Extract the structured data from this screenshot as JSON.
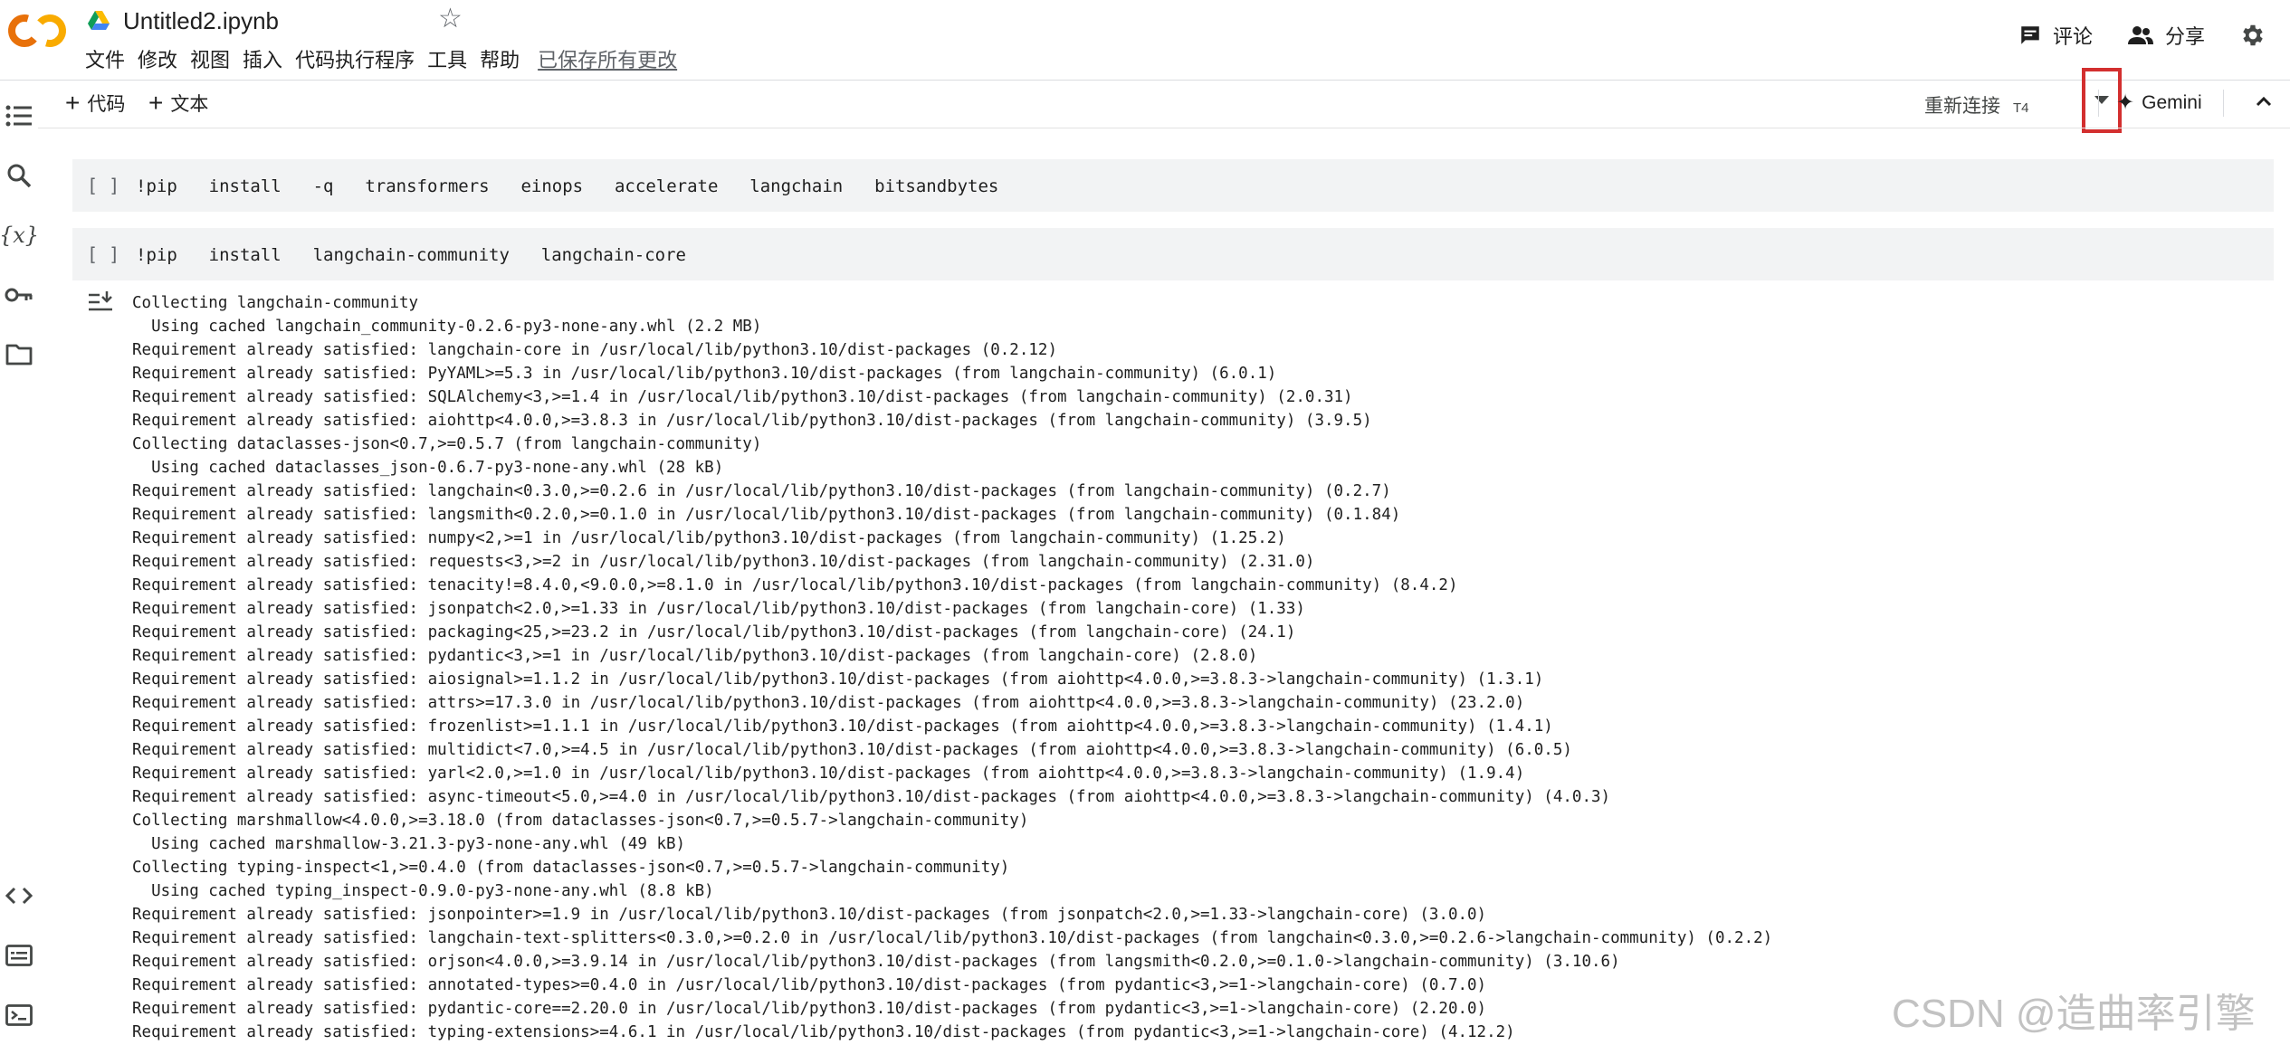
{
  "header": {
    "doc_title": "Untitled2.ipynb",
    "menus": [
      "文件",
      "修改",
      "视图",
      "插入",
      "代码执行程序",
      "工具",
      "帮助"
    ],
    "saved_status": "已保存所有更改",
    "comment_label": "评论",
    "share_label": "分享"
  },
  "toolbar": {
    "add_code_label": "代码",
    "add_text_label": "文本",
    "reconnect_label": "重新连接",
    "runtime_type": "T4",
    "gemini_label": "Gemini"
  },
  "cells": [
    {
      "bracket": "[ ]",
      "code": "!pip  install  -q  transformers  einops  accelerate  langchain  bitsandbytes"
    },
    {
      "bracket": "[ ]",
      "code": "!pip  install  langchain-community  langchain-core"
    }
  ],
  "output_lines": [
    "Collecting langchain-community",
    "  Using cached langchain_community-0.2.6-py3-none-any.whl (2.2 MB)",
    "Requirement already satisfied: langchain-core in /usr/local/lib/python3.10/dist-packages (0.2.12)",
    "Requirement already satisfied: PyYAML>=5.3 in /usr/local/lib/python3.10/dist-packages (from langchain-community) (6.0.1)",
    "Requirement already satisfied: SQLAlchemy<3,>=1.4 in /usr/local/lib/python3.10/dist-packages (from langchain-community) (2.0.31)",
    "Requirement already satisfied: aiohttp<4.0.0,>=3.8.3 in /usr/local/lib/python3.10/dist-packages (from langchain-community) (3.9.5)",
    "Collecting dataclasses-json<0.7,>=0.5.7 (from langchain-community)",
    "  Using cached dataclasses_json-0.6.7-py3-none-any.whl (28 kB)",
    "Requirement already satisfied: langchain<0.3.0,>=0.2.6 in /usr/local/lib/python3.10/dist-packages (from langchain-community) (0.2.7)",
    "Requirement already satisfied: langsmith<0.2.0,>=0.1.0 in /usr/local/lib/python3.10/dist-packages (from langchain-community) (0.1.84)",
    "Requirement already satisfied: numpy<2,>=1 in /usr/local/lib/python3.10/dist-packages (from langchain-community) (1.25.2)",
    "Requirement already satisfied: requests<3,>=2 in /usr/local/lib/python3.10/dist-packages (from langchain-community) (2.31.0)",
    "Requirement already satisfied: tenacity!=8.4.0,<9.0.0,>=8.1.0 in /usr/local/lib/python3.10/dist-packages (from langchain-community) (8.4.2)",
    "Requirement already satisfied: jsonpatch<2.0,>=1.33 in /usr/local/lib/python3.10/dist-packages (from langchain-core) (1.33)",
    "Requirement already satisfied: packaging<25,>=23.2 in /usr/local/lib/python3.10/dist-packages (from langchain-core) (24.1)",
    "Requirement already satisfied: pydantic<3,>=1 in /usr/local/lib/python3.10/dist-packages (from langchain-core) (2.8.0)",
    "Requirement already satisfied: aiosignal>=1.1.2 in /usr/local/lib/python3.10/dist-packages (from aiohttp<4.0.0,>=3.8.3->langchain-community) (1.3.1)",
    "Requirement already satisfied: attrs>=17.3.0 in /usr/local/lib/python3.10/dist-packages (from aiohttp<4.0.0,>=3.8.3->langchain-community) (23.2.0)",
    "Requirement already satisfied: frozenlist>=1.1.1 in /usr/local/lib/python3.10/dist-packages (from aiohttp<4.0.0,>=3.8.3->langchain-community) (1.4.1)",
    "Requirement already satisfied: multidict<7.0,>=4.5 in /usr/local/lib/python3.10/dist-packages (from aiohttp<4.0.0,>=3.8.3->langchain-community) (6.0.5)",
    "Requirement already satisfied: yarl<2.0,>=1.0 in /usr/local/lib/python3.10/dist-packages (from aiohttp<4.0.0,>=3.8.3->langchain-community) (1.9.4)",
    "Requirement already satisfied: async-timeout<5.0,>=4.0 in /usr/local/lib/python3.10/dist-packages (from aiohttp<4.0.0,>=3.8.3->langchain-community) (4.0.3)",
    "Collecting marshmallow<4.0.0,>=3.18.0 (from dataclasses-json<0.7,>=0.5.7->langchain-community)",
    "  Using cached marshmallow-3.21.3-py3-none-any.whl (49 kB)",
    "Collecting typing-inspect<1,>=0.4.0 (from dataclasses-json<0.7,>=0.5.7->langchain-community)",
    "  Using cached typing_inspect-0.9.0-py3-none-any.whl (8.8 kB)",
    "Requirement already satisfied: jsonpointer>=1.9 in /usr/local/lib/python3.10/dist-packages (from jsonpatch<2.0,>=1.33->langchain-core) (3.0.0)",
    "Requirement already satisfied: langchain-text-splitters<0.3.0,>=0.2.0 in /usr/local/lib/python3.10/dist-packages (from langchain<0.3.0,>=0.2.6->langchain-community) (0.2.2)",
    "Requirement already satisfied: orjson<4.0.0,>=3.9.14 in /usr/local/lib/python3.10/dist-packages (from langsmith<0.2.0,>=0.1.0->langchain-community) (3.10.6)",
    "Requirement already satisfied: annotated-types>=0.4.0 in /usr/local/lib/python3.10/dist-packages (from pydantic<3,>=1->langchain-core) (0.7.0)",
    "Requirement already satisfied: pydantic-core==2.20.0 in /usr/local/lib/python3.10/dist-packages (from pydantic<3,>=1->langchain-core) (2.20.0)",
    "Requirement already satisfied: typing-extensions>=4.6.1 in /usr/local/lib/python3.10/dist-packages (from pydantic<3,>=1->langchain-core) (4.12.2)"
  ],
  "watermark": "CSDN @造曲率引擎",
  "colors": {
    "logo_orange": "#F9AB00",
    "logo_dark_orange": "#E8710A",
    "highlight_red": "#D32F2F",
    "cell_background": "#F2F3F4"
  },
  "icons": {
    "rail": [
      "table-of-contents-icon",
      "search-icon",
      "variables-icon",
      "secrets-key-icon",
      "folder-icon",
      "code-snippets-icon",
      "command-palette-icon",
      "terminal-icon"
    ],
    "header": [
      "comment-icon",
      "people-icon",
      "gear-icon",
      "star-icon",
      "drive-icon"
    ]
  }
}
